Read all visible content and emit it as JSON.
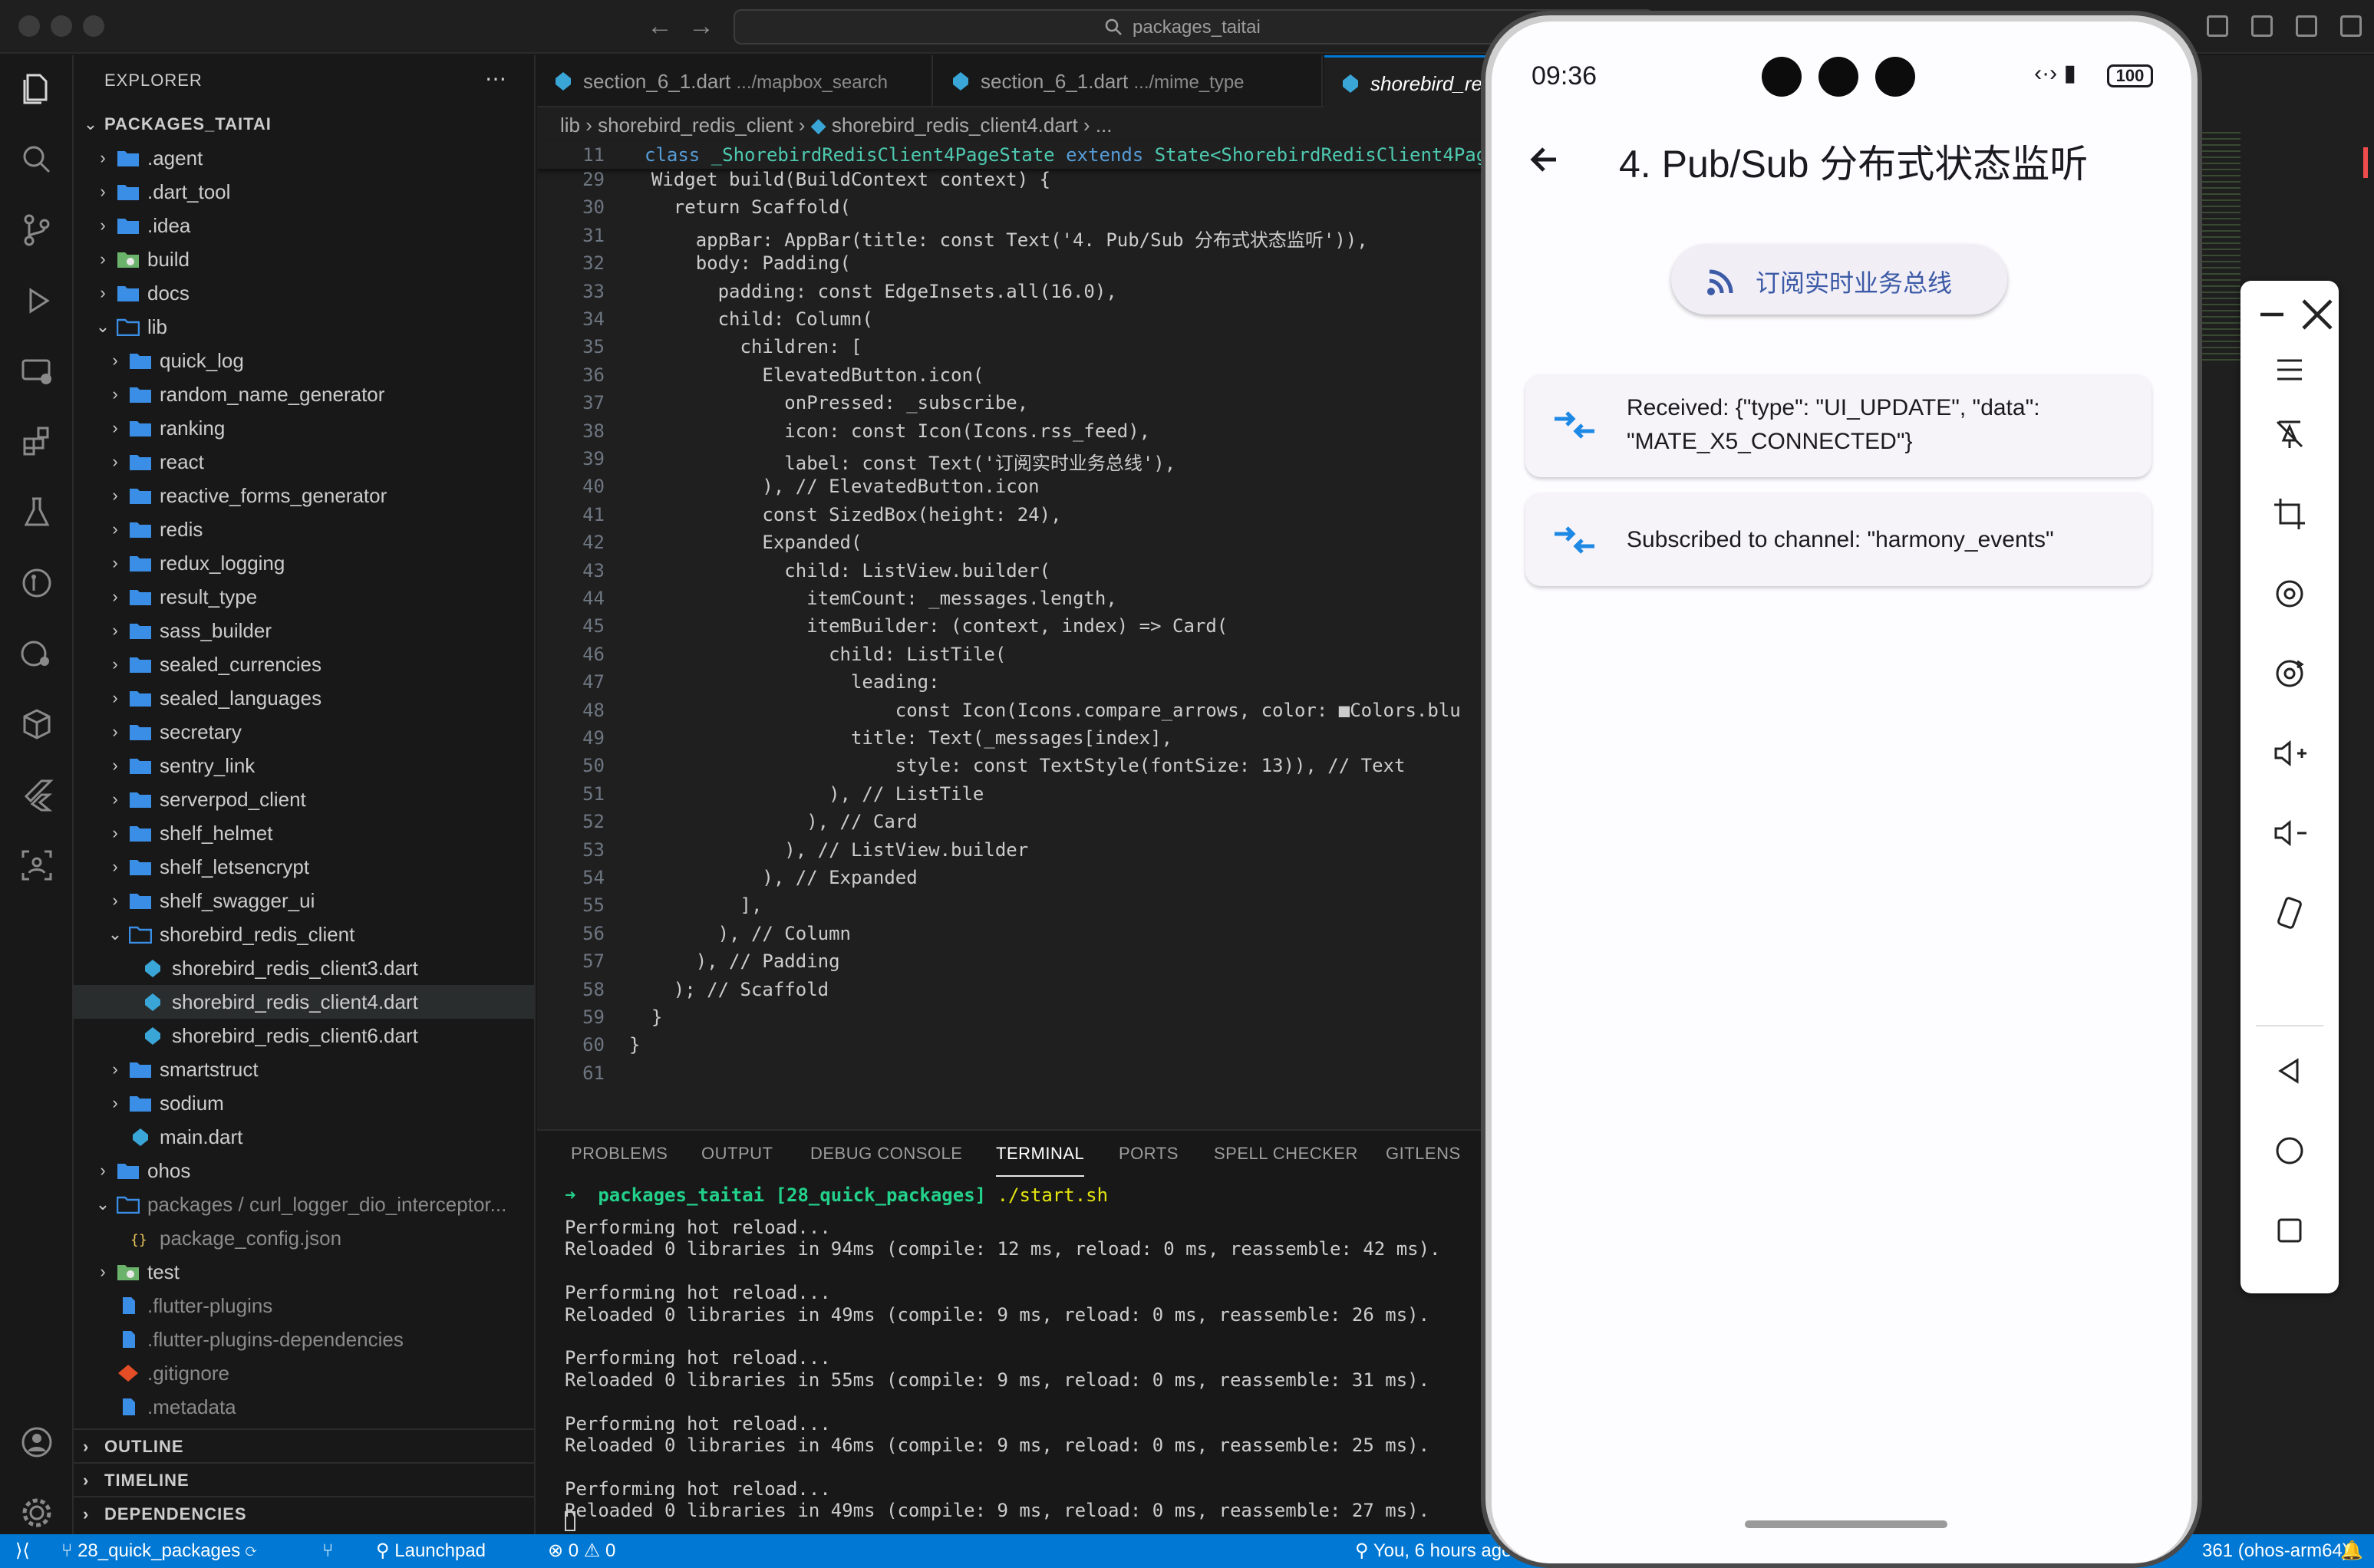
{
  "window": {
    "search": "packages_taitai"
  },
  "explorer": {
    "header": "EXPLORER",
    "root": "PACKAGES_TAITAI",
    "items": [
      {
        "label": ".agent",
        "depth": 1,
        "kind": "folder",
        "open": false
      },
      {
        "label": ".dart_tool",
        "depth": 1,
        "kind": "folder",
        "open": false
      },
      {
        "label": ".idea",
        "depth": 1,
        "kind": "folder",
        "open": false
      },
      {
        "label": "build",
        "depth": 1,
        "kind": "folder-special",
        "open": false
      },
      {
        "label": "docs",
        "depth": 1,
        "kind": "folder",
        "open": false
      },
      {
        "label": "lib",
        "depth": 1,
        "kind": "folder-open",
        "open": true
      },
      {
        "label": "quick_log",
        "depth": 2,
        "kind": "folder",
        "open": false
      },
      {
        "label": "random_name_generator",
        "depth": 2,
        "kind": "folder",
        "open": false
      },
      {
        "label": "ranking",
        "depth": 2,
        "kind": "folder",
        "open": false
      },
      {
        "label": "react",
        "depth": 2,
        "kind": "folder",
        "open": false
      },
      {
        "label": "reactive_forms_generator",
        "depth": 2,
        "kind": "folder",
        "open": false
      },
      {
        "label": "redis",
        "depth": 2,
        "kind": "folder",
        "open": false
      },
      {
        "label": "redux_logging",
        "depth": 2,
        "kind": "folder",
        "open": false
      },
      {
        "label": "result_type",
        "depth": 2,
        "kind": "folder",
        "open": false
      },
      {
        "label": "sass_builder",
        "depth": 2,
        "kind": "folder",
        "open": false
      },
      {
        "label": "sealed_currencies",
        "depth": 2,
        "kind": "folder",
        "open": false
      },
      {
        "label": "sealed_languages",
        "depth": 2,
        "kind": "folder",
        "open": false
      },
      {
        "label": "secretary",
        "depth": 2,
        "kind": "folder",
        "open": false
      },
      {
        "label": "sentry_link",
        "depth": 2,
        "kind": "folder",
        "open": false
      },
      {
        "label": "serverpod_client",
        "depth": 2,
        "kind": "folder",
        "open": false
      },
      {
        "label": "shelf_helmet",
        "depth": 2,
        "kind": "folder",
        "open": false
      },
      {
        "label": "shelf_letsencrypt",
        "depth": 2,
        "kind": "folder",
        "open": false
      },
      {
        "label": "shelf_swagger_ui",
        "depth": 2,
        "kind": "folder",
        "open": false
      },
      {
        "label": "shorebird_redis_client",
        "depth": 2,
        "kind": "folder-open",
        "open": true
      },
      {
        "label": "shorebird_redis_client3.dart",
        "depth": 3,
        "kind": "dart",
        "open": false
      },
      {
        "label": "shorebird_redis_client4.dart",
        "depth": 3,
        "kind": "dart",
        "open": false,
        "selected": true
      },
      {
        "label": "shorebird_redis_client6.dart",
        "depth": 3,
        "kind": "dart",
        "open": false
      },
      {
        "label": "smartstruct",
        "depth": 2,
        "kind": "folder",
        "open": false
      },
      {
        "label": "sodium",
        "depth": 2,
        "kind": "folder",
        "open": false
      },
      {
        "label": "main.dart",
        "depth": 2,
        "kind": "dart",
        "open": false
      },
      {
        "label": "ohos",
        "depth": 1,
        "kind": "folder",
        "open": false
      },
      {
        "label": "packages / curl_logger_dio_interceptor...",
        "depth": 1,
        "kind": "folder-open",
        "open": true
      },
      {
        "label": "package_config.json",
        "depth": 2,
        "kind": "json",
        "open": false
      },
      {
        "label": "test",
        "depth": 1,
        "kind": "folder-special",
        "open": false
      },
      {
        "label": ".flutter-plugins",
        "depth": 1,
        "kind": "file",
        "open": false
      },
      {
        "label": ".flutter-plugins-dependencies",
        "depth": 1,
        "kind": "file",
        "open": false
      },
      {
        "label": ".gitignore",
        "depth": 1,
        "kind": "git",
        "open": false
      },
      {
        "label": ".metadata",
        "depth": 1,
        "kind": "file",
        "open": false
      }
    ],
    "sections": [
      "OUTLINE",
      "TIMELINE",
      "DEPENDENCIES"
    ]
  },
  "tabs": [
    {
      "name": "section_6_1.dart",
      "path": ".../mapbox_search"
    },
    {
      "name": "section_6_1.dart",
      "path": ".../mime_type"
    },
    {
      "name": "shorebird_re",
      "path": ""
    }
  ],
  "breadcrumb": [
    "lib",
    "shorebird_redis_client",
    "shorebird_redis_client4.dart",
    "..."
  ],
  "code": {
    "sticky_line": "11",
    "sticky_text": "class _ShorebirdRedisClient4PageState extends State<ShorebirdRedisClient4Pag",
    "lines": [
      {
        "n": "29",
        "t": "  Widget build(BuildContext context) {"
      },
      {
        "n": "30",
        "t": "    return Scaffold("
      },
      {
        "n": "31",
        "t": "      appBar: AppBar(title: const Text('4. Pub/Sub 分布式状态监听')),"
      },
      {
        "n": "32",
        "t": "      body: Padding("
      },
      {
        "n": "33",
        "t": "        padding: const EdgeInsets.all(16.0),"
      },
      {
        "n": "34",
        "t": "        child: Column("
      },
      {
        "n": "35",
        "t": "          children: ["
      },
      {
        "n": "36",
        "t": "            ElevatedButton.icon("
      },
      {
        "n": "37",
        "t": "              onPressed: _subscribe,"
      },
      {
        "n": "38",
        "t": "              icon: const Icon(Icons.rss_feed),"
      },
      {
        "n": "39",
        "t": "              label: const Text('订阅实时业务总线'),"
      },
      {
        "n": "40",
        "t": "            ), // ElevatedButton.icon"
      },
      {
        "n": "41",
        "t": "            const SizedBox(height: 24),"
      },
      {
        "n": "42",
        "t": "            Expanded("
      },
      {
        "n": "43",
        "t": "              child: ListView.builder("
      },
      {
        "n": "44",
        "t": "                itemCount: _messages.length,"
      },
      {
        "n": "45",
        "t": "                itemBuilder: (context, index) => Card("
      },
      {
        "n": "46",
        "t": "                  child: ListTile("
      },
      {
        "n": "47",
        "t": "                    leading:"
      },
      {
        "n": "48",
        "t": "                        const Icon(Icons.compare_arrows, color: ■Colors.blu"
      },
      {
        "n": "49",
        "t": "                    title: Text(_messages[index],"
      },
      {
        "n": "50",
        "t": "                        style: const TextStyle(fontSize: 13)), // Text"
      },
      {
        "n": "51",
        "t": "                  ), // ListTile"
      },
      {
        "n": "52",
        "t": "                ), // Card"
      },
      {
        "n": "53",
        "t": "              ), // ListView.builder"
      },
      {
        "n": "54",
        "t": "            ), // Expanded"
      },
      {
        "n": "55",
        "t": "          ],"
      },
      {
        "n": "56",
        "t": "        ), // Column"
      },
      {
        "n": "57",
        "t": "      ), // Padding"
      },
      {
        "n": "58",
        "t": "    ); // Scaffold"
      },
      {
        "n": "59",
        "t": "  }"
      },
      {
        "n": "60",
        "t": "}"
      },
      {
        "n": "61",
        "t": ""
      }
    ]
  },
  "panel": {
    "tabs": [
      "PROBLEMS",
      "OUTPUT",
      "DEBUG CONSOLE",
      "TERMINAL",
      "PORTS",
      "SPELL CHECKER",
      "GITLENS"
    ],
    "active_tab": "TERMINAL",
    "prompt_dir": "packages_taitai",
    "prompt_branch": "[28_quick_packages]",
    "prompt_cmd": "./start.sh",
    "lines": [
      "Performing hot reload...",
      "Reloaded 0 libraries in 94ms (compile: 12 ms, reload: 0 ms, reassemble: 42 ms).",
      "",
      "Performing hot reload...",
      "Reloaded 0 libraries in 49ms (compile: 9 ms, reload: 0 ms, reassemble: 26 ms).",
      "",
      "Performing hot reload...",
      "Reloaded 0 libraries in 55ms (compile: 9 ms, reload: 0 ms, reassemble: 31 ms).",
      "",
      "Performing hot reload...",
      "Reloaded 0 libraries in 46ms (compile: 9 ms, reload: 0 ms, reassemble: 25 ms).",
      "",
      "Performing hot reload...",
      "Reloaded 0 libraries in 49ms (compile: 9 ms, reload: 0 ms, reassemble: 27 ms)."
    ]
  },
  "statusbar": {
    "branch": "28_quick_packages",
    "launchpad": "Launchpad",
    "errors": "0",
    "warnings": "0",
    "blame": "You, 6 hours ago",
    "device": "361 (ohos-arm64)"
  },
  "phone": {
    "time": "09:36",
    "battery": "100",
    "title": "4. Pub/Sub 分布式状态监听",
    "button_label": "订阅实时业务总线",
    "messages": [
      "Received: {\"type\": \"UI_UPDATE\", \"data\": \"MATE_X5_CONNECTED\"}",
      "Subscribed to channel: \"harmony_events\""
    ],
    "accent": "#1e88e5"
  }
}
